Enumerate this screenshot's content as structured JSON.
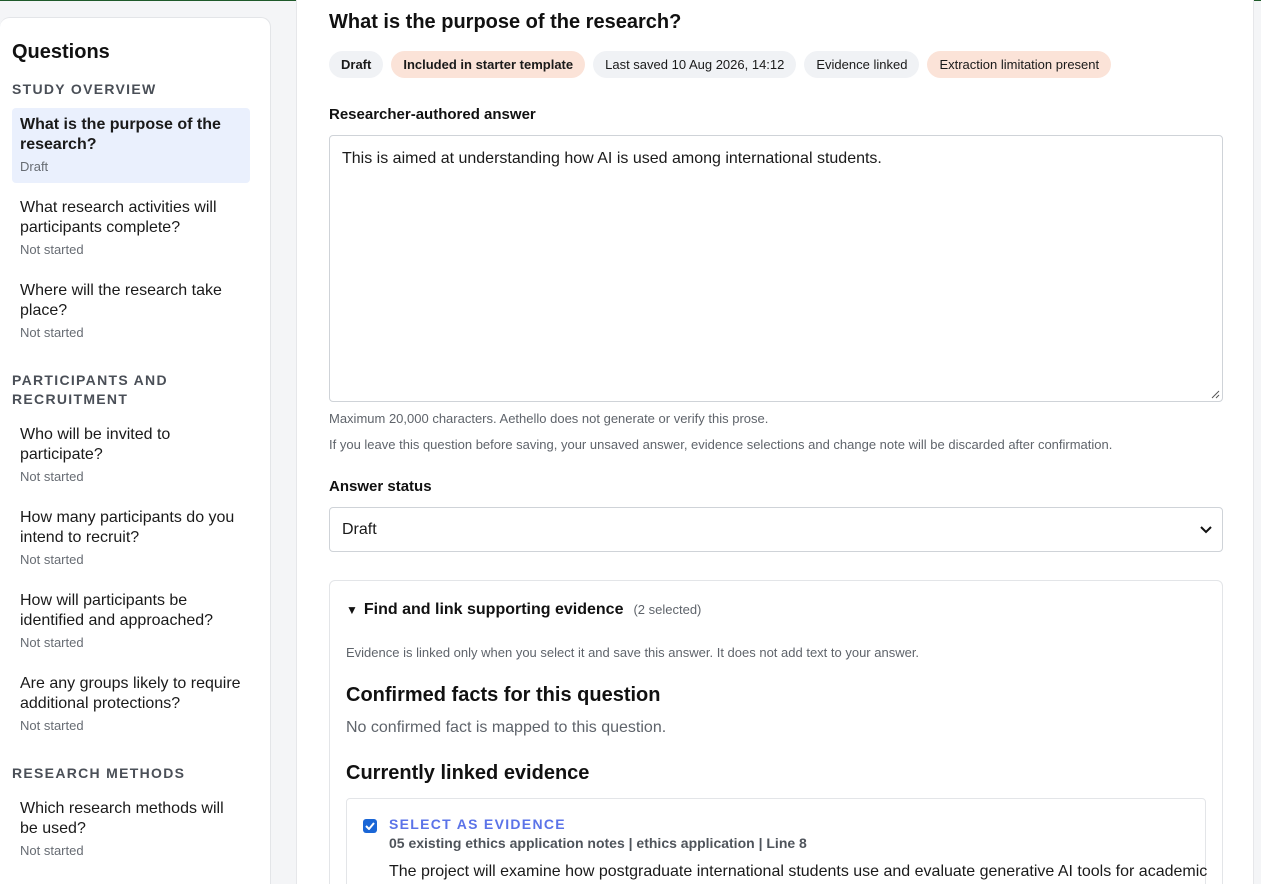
{
  "sidebar": {
    "title": "Questions",
    "sections": [
      {
        "heading": "STUDY OVERVIEW",
        "items": [
          {
            "label": "What is the purpose of the research?",
            "status": "Draft"
          },
          {
            "label": "What research activities will participants complete?",
            "status": "Not started"
          },
          {
            "label": "Where will the research take place?",
            "status": "Not started"
          }
        ]
      },
      {
        "heading": "PARTICIPANTS AND RECRUITMENT",
        "items": [
          {
            "label": "Who will be invited to participate?",
            "status": "Not started"
          },
          {
            "label": "How many participants do you intend to recruit?",
            "status": "Not started"
          },
          {
            "label": "How will participants be identified and approached?",
            "status": "Not started"
          },
          {
            "label": "Are any groups likely to require additional protections?",
            "status": "Not started"
          }
        ]
      },
      {
        "heading": "RESEARCH METHODS",
        "items": [
          {
            "label": "Which research methods will be used?",
            "status": "Not started"
          }
        ]
      }
    ]
  },
  "main": {
    "title": "What is the purpose of the research?",
    "chips": {
      "status": "Draft",
      "template": "Included in starter template",
      "saved": "Last saved 10 Aug 2026, 14:12",
      "evidence": "Evidence linked",
      "limitation": "Extraction limitation present"
    },
    "answer_label": "Researcher-authored answer",
    "answer_value": "This is aimed at understanding how AI is used among international students.",
    "help_max": "Maximum 20,000 characters. Aethello does not generate or verify this prose.",
    "help_leave": "If you leave this question before saving, your unsaved answer, evidence selections and change note will be discarded after confirmation.",
    "status_label": "Answer status",
    "status_value": "Draft",
    "evidence": {
      "summary_title": "Find and link supporting evidence",
      "summary_count": "(2 selected)",
      "note": "Evidence is linked only when you select it and save this answer. It does not add text to your answer.",
      "confirmed_heading": "Confirmed facts for this question",
      "confirmed_empty": "No confirmed fact is mapped to this question.",
      "linked_heading": "Currently linked evidence",
      "card": {
        "select_label": "SELECT AS EVIDENCE",
        "meta": "05 existing ethics application notes | ethics application | Line 8",
        "text": "The project will examine how postgraduate international students use and evaluate generative AI tools for academic"
      }
    }
  },
  "colors": {
    "accent": "#1a66d6",
    "active_item_bg": "#eaf0fd",
    "warn_chip": "#fbe3d8",
    "select_link": "#5b73e8"
  }
}
